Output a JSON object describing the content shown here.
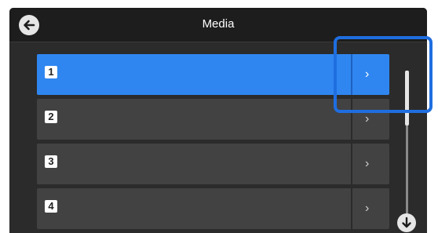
{
  "header": {
    "title": "Media",
    "back_icon": "arrow-left-icon"
  },
  "list": {
    "items": [
      {
        "label": "1",
        "selected": true,
        "action_icon": "chevron-right-icon",
        "action_glyph": "›"
      },
      {
        "label": "2",
        "selected": false,
        "action_icon": "chevron-right-icon",
        "action_glyph": "›"
      },
      {
        "label": "3",
        "selected": false,
        "action_icon": "chevron-right-icon",
        "action_glyph": "›"
      },
      {
        "label": "4",
        "selected": false,
        "action_icon": "chevron-right-icon",
        "action_glyph": "›"
      }
    ]
  },
  "scrollbar": {
    "down_icon": "arrow-down-icon"
  },
  "colors": {
    "selected": "#2f86f0",
    "highlight_outline": "#1f6ee0",
    "row": "#424242",
    "background": "#2b2b2b"
  }
}
